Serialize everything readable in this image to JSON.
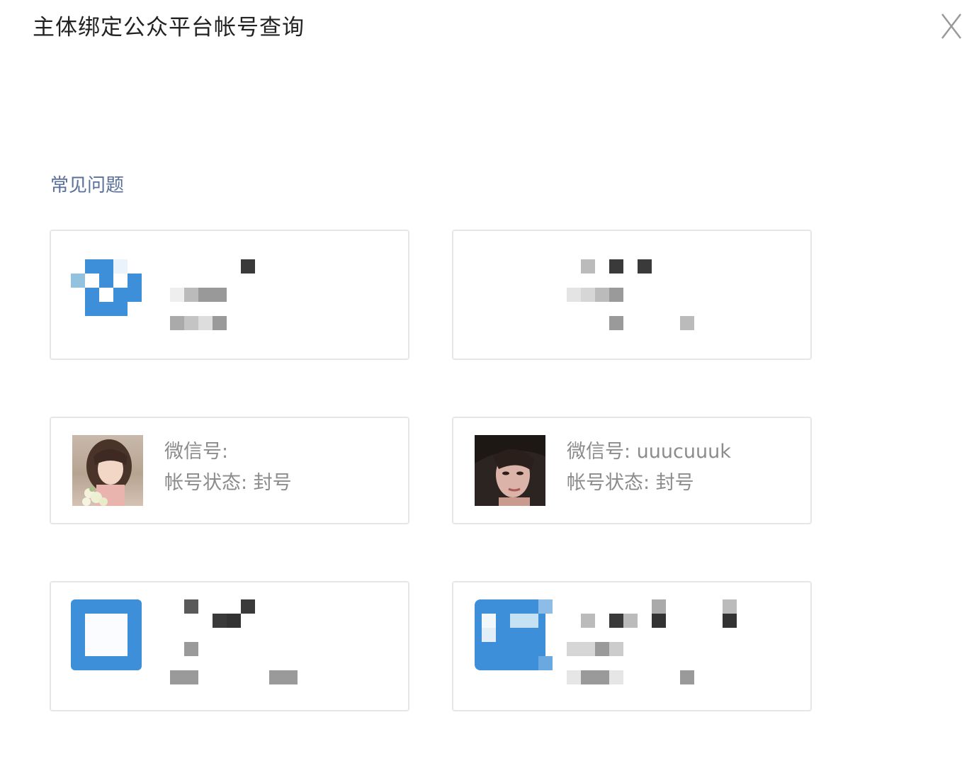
{
  "dialog": {
    "title": "主体绑定公众平台帐号查询",
    "close_icon": "close-icon"
  },
  "faq": {
    "label": "常见问题"
  },
  "accounts": [
    {
      "wechat_line": "微信号:",
      "status_line": "帐号状态: 封号"
    },
    {
      "wechat_line": "微信号: uuucuuuk",
      "status_line": "帐号状态: 封号"
    }
  ],
  "colors": {
    "faq_link": "#5b6f9c",
    "avatar_blue": "#3d8fd9",
    "card_border": "#e6e6e6",
    "info_text": "#8c8c8c"
  }
}
